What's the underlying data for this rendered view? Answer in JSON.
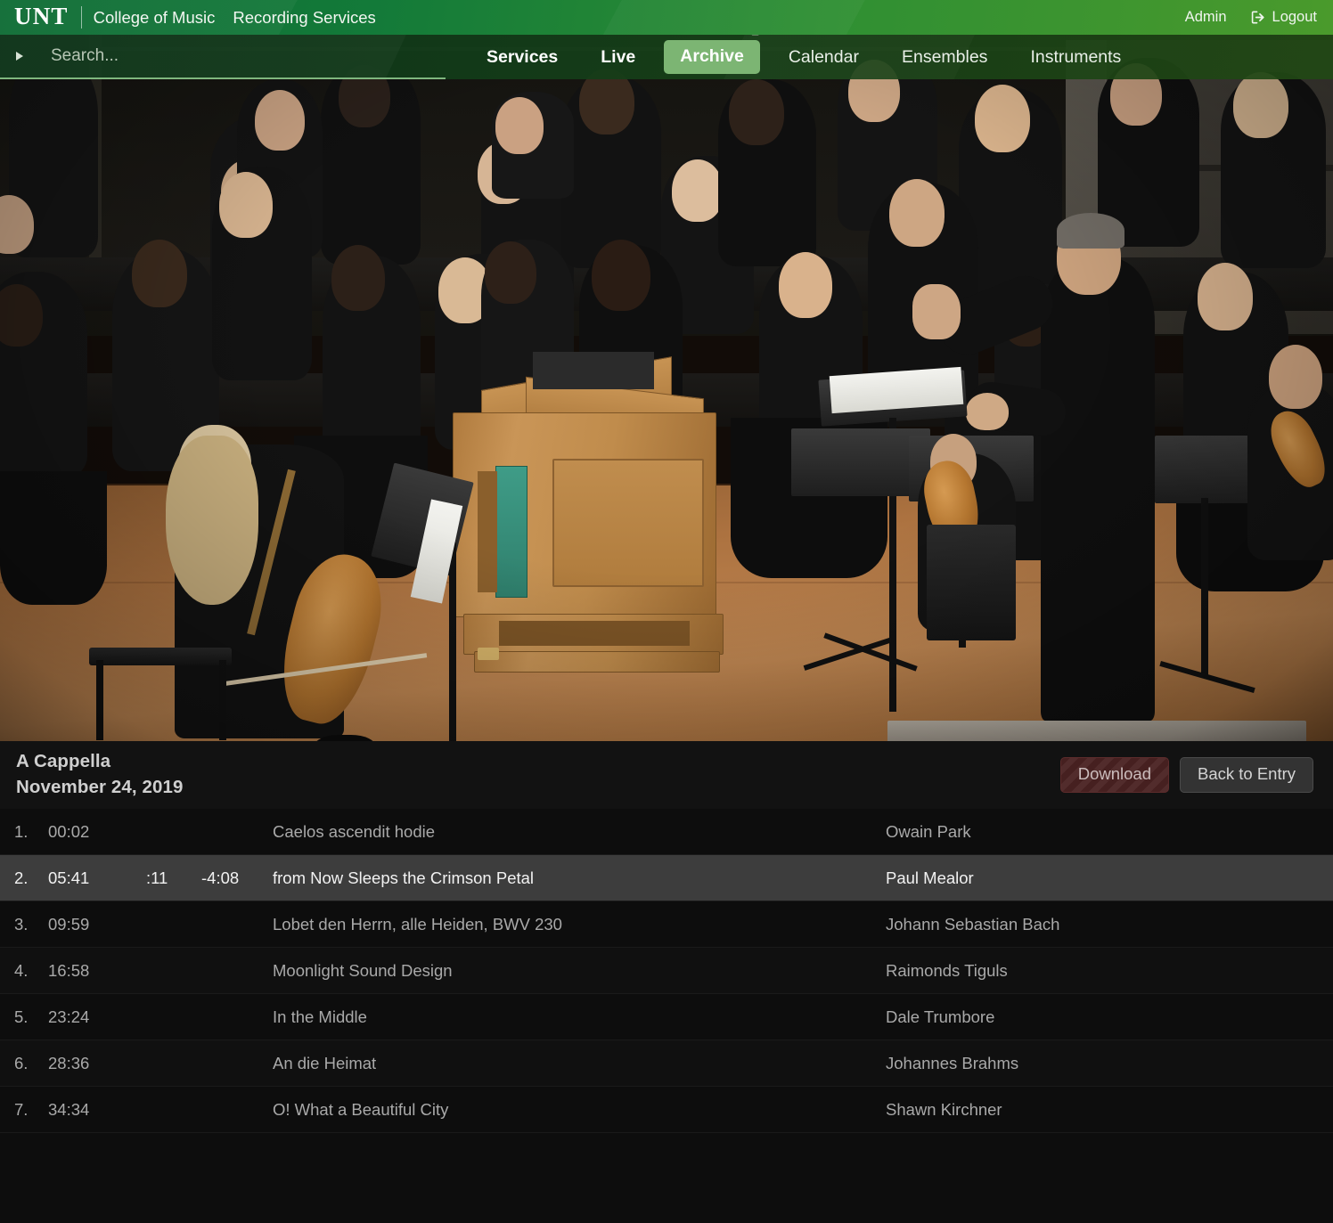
{
  "brand": {
    "logo": "UNT",
    "college": "College of Music",
    "department": "Recording Services",
    "admin_label": "Admin",
    "logout_label": "Logout",
    "logout_icon": "logout-arrow-icon",
    "bar_color": "#137a39"
  },
  "search": {
    "placeholder": "Search...",
    "value": "",
    "caret_icon": "triangle-right-icon",
    "underline_color": "#7fb77e"
  },
  "nav": {
    "items": [
      {
        "label": "Services",
        "active": false,
        "bold": true
      },
      {
        "label": "Live",
        "active": false,
        "bold": true
      },
      {
        "label": "Archive",
        "active": true,
        "bold": true
      },
      {
        "label": "Calendar",
        "active": false,
        "bold": false
      },
      {
        "label": "Ensembles",
        "active": false,
        "bold": false
      },
      {
        "label": "Instruments",
        "active": false,
        "bold": false
      }
    ],
    "active_badge_color": "#7cb573",
    "lock_icon": "unlock-open-icon"
  },
  "player": {
    "media_alt": "Choir performing on stage with conductor, chamber organ and string players"
  },
  "entry": {
    "title": "A Cappella",
    "date": "November 24, 2019",
    "download_label": "Download",
    "back_label": "Back to Entry"
  },
  "tracks": [
    {
      "num": "1.",
      "start": "00:02",
      "elapsed": "",
      "remaining": "",
      "title": "Caelos ascendit hodie",
      "composer": "Owain Park",
      "active": false
    },
    {
      "num": "2.",
      "start": "05:41",
      "elapsed": ":11",
      "remaining": "-4:08",
      "title": "from Now Sleeps the Crimson Petal",
      "composer": "Paul Mealor",
      "active": true
    },
    {
      "num": "3.",
      "start": "09:59",
      "elapsed": "",
      "remaining": "",
      "title": "Lobet den Herrn, alle Heiden, BWV 230",
      "composer": "Johann Sebastian Bach",
      "active": false
    },
    {
      "num": "4.",
      "start": "16:58",
      "elapsed": "",
      "remaining": "",
      "title": "Moonlight Sound Design",
      "composer": "Raimonds Tiguls",
      "active": false
    },
    {
      "num": "5.",
      "start": "23:24",
      "elapsed": "",
      "remaining": "",
      "title": "In the Middle",
      "composer": "Dale Trumbore",
      "active": false
    },
    {
      "num": "6.",
      "start": "28:36",
      "elapsed": "",
      "remaining": "",
      "title": "An die Heimat",
      "composer": "Johannes Brahms",
      "active": false
    },
    {
      "num": "7.",
      "start": "34:34",
      "elapsed": "",
      "remaining": "",
      "title": "O! What a Beautiful City",
      "composer": "Shawn Kirchner",
      "active": false
    }
  ]
}
